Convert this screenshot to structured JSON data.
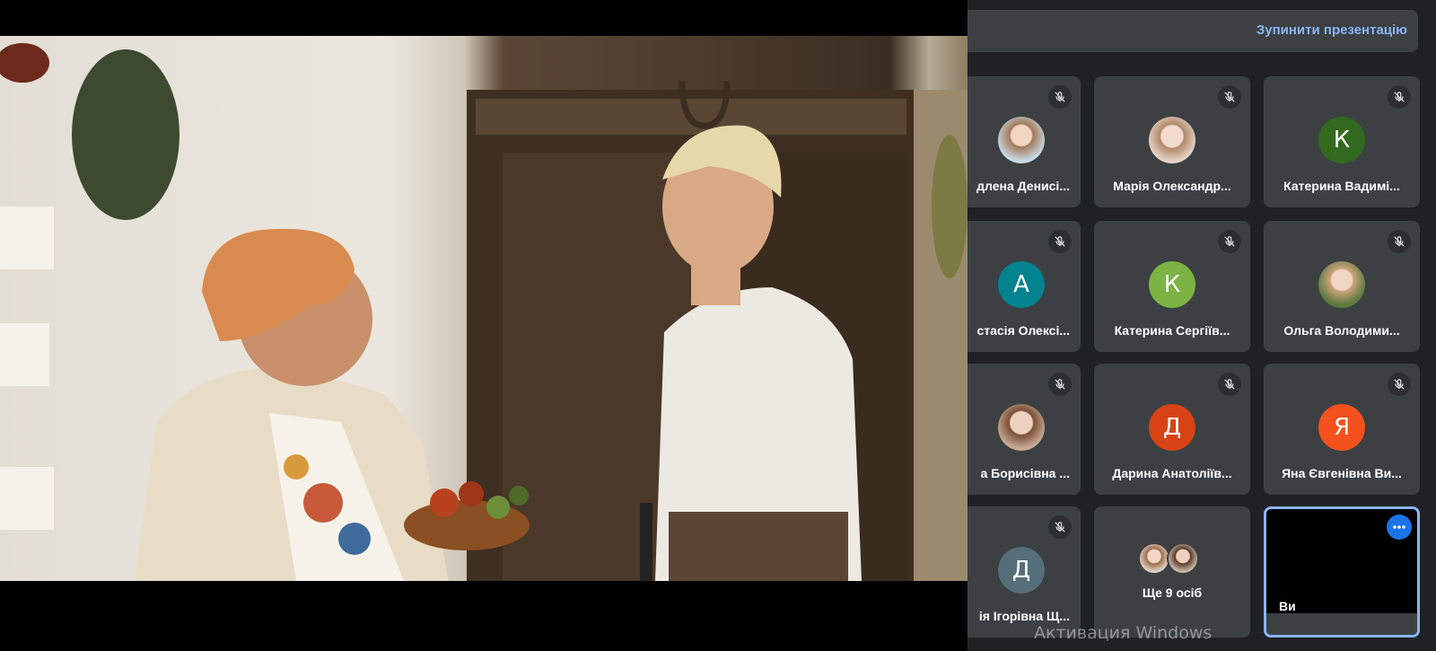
{
  "presentation": {
    "stop_label": "Зупинити презентацію"
  },
  "participants": [
    {
      "name": "длена Денисі...",
      "avatar_type": "photo",
      "muted": true
    },
    {
      "name": "Марія Олександр...",
      "avatar_type": "photo",
      "muted": true
    },
    {
      "name": "Катерина Вадимі...",
      "avatar_type": "initial",
      "initial": "К",
      "color": "#33691e",
      "muted": true
    },
    {
      "name": "стасія Олексі...",
      "avatar_type": "initial",
      "initial": "А",
      "color": "#00838f",
      "muted": true
    },
    {
      "name": "Катерина Сергіїв...",
      "avatar_type": "initial",
      "initial": "К",
      "color": "#7cb342",
      "muted": true
    },
    {
      "name": "Ольга Володими...",
      "avatar_type": "photo",
      "muted": true
    },
    {
      "name": "а Борисівна ...",
      "avatar_type": "photo",
      "muted": true
    },
    {
      "name": "Дарина Анатоліїв...",
      "avatar_type": "initial",
      "initial": "Д",
      "color": "#d84315",
      "muted": true
    },
    {
      "name": "Яна Євгенівна Ви...",
      "avatar_type": "initial",
      "initial": "Я",
      "color": "#f4511e",
      "muted": true
    },
    {
      "name": "ія Ігорівна Щ...",
      "avatar_type": "initial",
      "initial": "Д",
      "color": "#546e7a",
      "muted": true
    }
  ],
  "more_tile": {
    "label": "Ще 9 осіб"
  },
  "self_tile": {
    "label": "Ви"
  },
  "watermark": "Активация Windows",
  "icons": {
    "mic_off": "mic-off-icon",
    "more": "more-options-icon"
  },
  "colors": {
    "accent": "#8ab4f8",
    "panel_bg": "#202124",
    "tile_bg": "#3c4043",
    "self_border": "#8ab4f8",
    "more_button": "#1a73e8"
  }
}
